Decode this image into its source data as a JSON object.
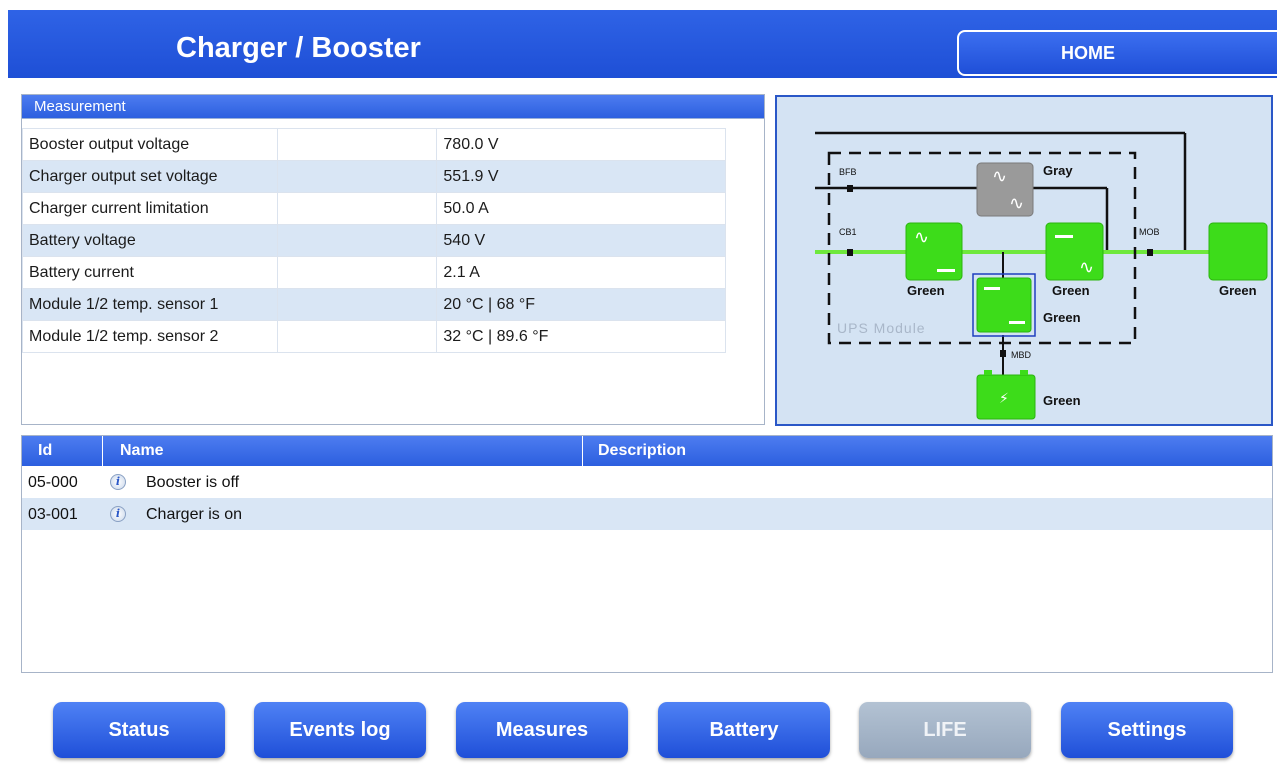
{
  "header": {
    "title": "Charger / Booster",
    "home_label": "HOME"
  },
  "measurement": {
    "title": "Measurement",
    "rows": [
      {
        "label": "Booster output voltage",
        "value": "780.0 V"
      },
      {
        "label": "Charger output set voltage",
        "value": "551.9 V"
      },
      {
        "label": "Charger current limitation",
        "value": "50.0 A"
      },
      {
        "label": "Battery voltage",
        "value": "540 V"
      },
      {
        "label": "Battery current",
        "value": "2.1 A"
      },
      {
        "label": "Module 1/2 temp. sensor 1",
        "value": "20 °C | 68 °F"
      },
      {
        "label": "Module 1/2 temp. sensor 2",
        "value": "32 °C | 89.6 °F"
      }
    ]
  },
  "diagram": {
    "switches": {
      "bfb": "BFB",
      "cb1": "CB1",
      "mob": "MOB",
      "mbd": "MBD"
    },
    "module_label": "UPS Module",
    "bypass_status": "Gray",
    "rectifier_status": "Green",
    "inverter_status": "Green",
    "output_status": "Green",
    "charger_status": "Green",
    "battery_status": "Green",
    "colors": {
      "green": "#3ddc1a",
      "gray": "#9a9a9a",
      "line": "#6ee83c"
    }
  },
  "events": {
    "columns": [
      "Id",
      "Name",
      "Description"
    ],
    "rows": [
      {
        "id": "05-000",
        "name": "Booster is off",
        "icon": "info-icon"
      },
      {
        "id": "03-001",
        "name": "Charger is on",
        "icon": "info-icon"
      }
    ]
  },
  "nav": {
    "status": "Status",
    "events_log": "Events log",
    "measures": "Measures",
    "battery": "Battery",
    "life": "LIFE",
    "settings": "Settings"
  }
}
